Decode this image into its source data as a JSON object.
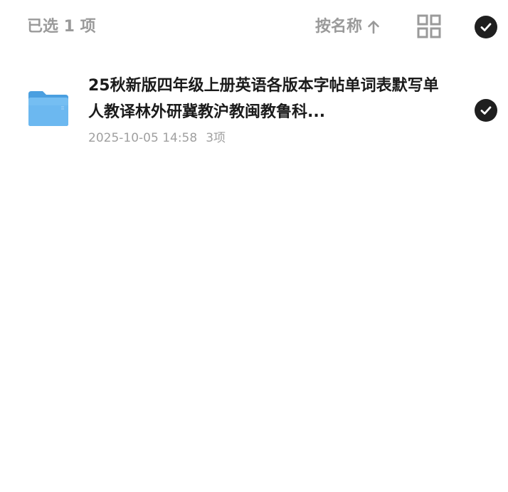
{
  "header": {
    "selected_text": "已选 1 项",
    "sort_label": "按名称",
    "sort_icon": "arrow-up-icon",
    "view_icon": "grid-view-icon",
    "select_all_icon": "check-circle-icon"
  },
  "files": [
    {
      "name": "25秋新版四年级上册英语各版本字帖单词表默写单人教译林外研冀教沪教闽教鲁科...",
      "date": "2025-10-05 14:58",
      "count": "3项",
      "icon": "folder-icon",
      "selected": true
    }
  ],
  "colors": {
    "accent": "#1f1f1f",
    "folder": "#5aaeea",
    "muted_text": "#9a9a9a"
  }
}
